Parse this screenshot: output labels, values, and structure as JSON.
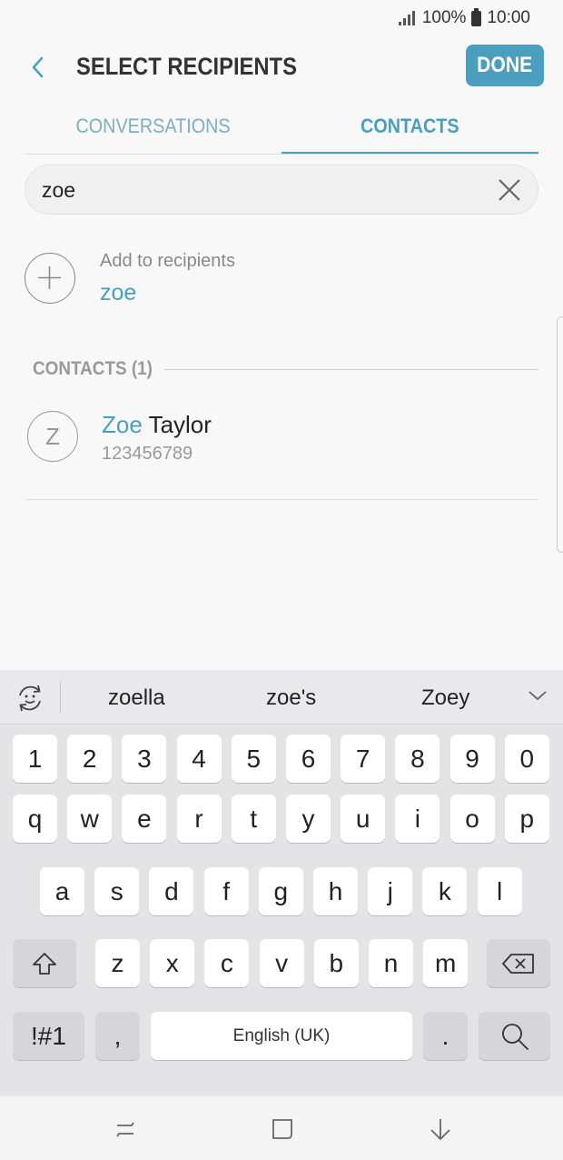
{
  "status_bar": {
    "battery": "100%",
    "time": "10:00"
  },
  "header": {
    "title": "SELECT RECIPIENTS",
    "done_label": "DONE"
  },
  "tabs": [
    {
      "label": "CONVERSATIONS",
      "active": false
    },
    {
      "label": "CONTACTS",
      "active": true
    }
  ],
  "search": {
    "value": "zoe"
  },
  "add_recipient": {
    "label": "Add to recipients",
    "value": "zoe"
  },
  "contacts_section": {
    "title": "CONTACTS (1)"
  },
  "contacts": [
    {
      "initial": "Z",
      "name_match": "Zoe",
      "name_rest": " Taylor",
      "number": "123456789"
    }
  ],
  "keyboard": {
    "suggestions": [
      "zoella",
      "zoe's",
      "Zoey"
    ],
    "row_numbers": [
      "1",
      "2",
      "3",
      "4",
      "5",
      "6",
      "7",
      "8",
      "9",
      "0"
    ],
    "row1": [
      "q",
      "w",
      "e",
      "r",
      "t",
      "y",
      "u",
      "i",
      "o",
      "p"
    ],
    "row2": [
      "a",
      "s",
      "d",
      "f",
      "g",
      "h",
      "j",
      "k",
      "l"
    ],
    "row3": [
      "z",
      "x",
      "c",
      "v",
      "b",
      "n",
      "m"
    ],
    "symbols_label": "!#1",
    "comma_label": ",",
    "space_label": "English (UK)",
    "period_label": "."
  },
  "colors": {
    "accent": "#4a9fbf",
    "background": "#f8f8f8",
    "keyboard_bg": "#e4e4e6"
  }
}
